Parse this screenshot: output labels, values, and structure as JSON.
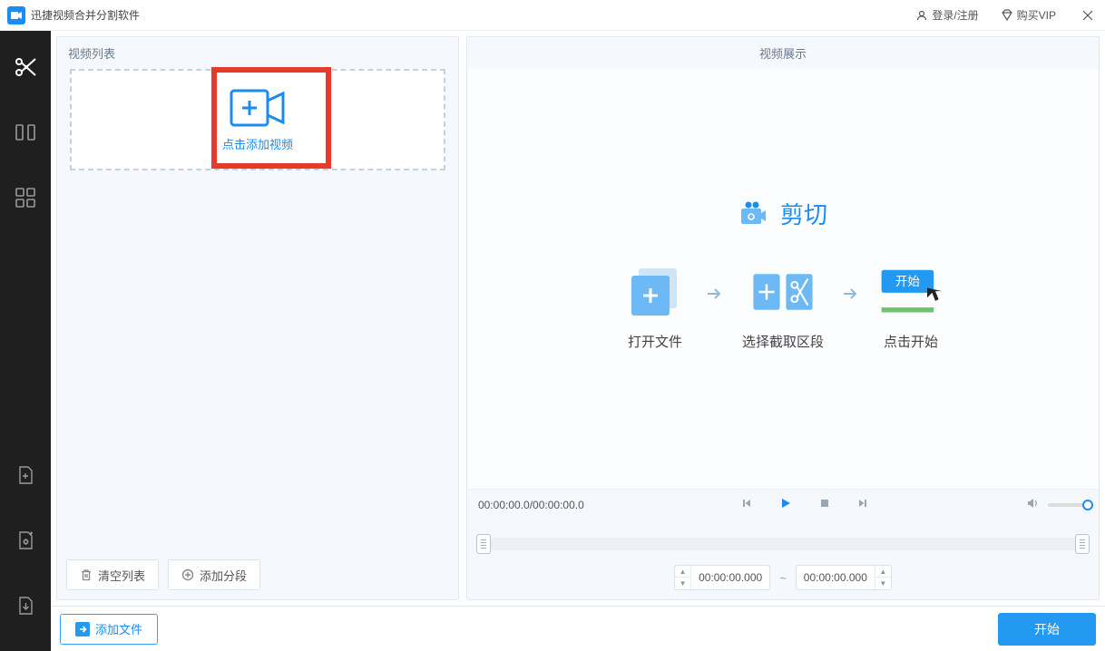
{
  "titlebar": {
    "app_name": "迅捷视频合并分割软件",
    "login": "登录/注册",
    "buy_vip": "购买VIP"
  },
  "panels": {
    "list_header": "视频列表",
    "preview_header": "视频展示"
  },
  "dropzone": {
    "label": "点击添加视频"
  },
  "left_footer": {
    "clear": "清空列表",
    "add_segment": "添加分段"
  },
  "preview": {
    "title": "剪切",
    "step1": "打开文件",
    "step2": "选择截取区段",
    "step3": "点击开始",
    "start_chip": "开始"
  },
  "controls": {
    "time": "00:00:00.0/00:00:00.0"
  },
  "range": {
    "start": "00:00:00.000",
    "end": "00:00:00.000",
    "sep": "~"
  },
  "bottom": {
    "add_file": "添加文件",
    "start": "开始"
  }
}
